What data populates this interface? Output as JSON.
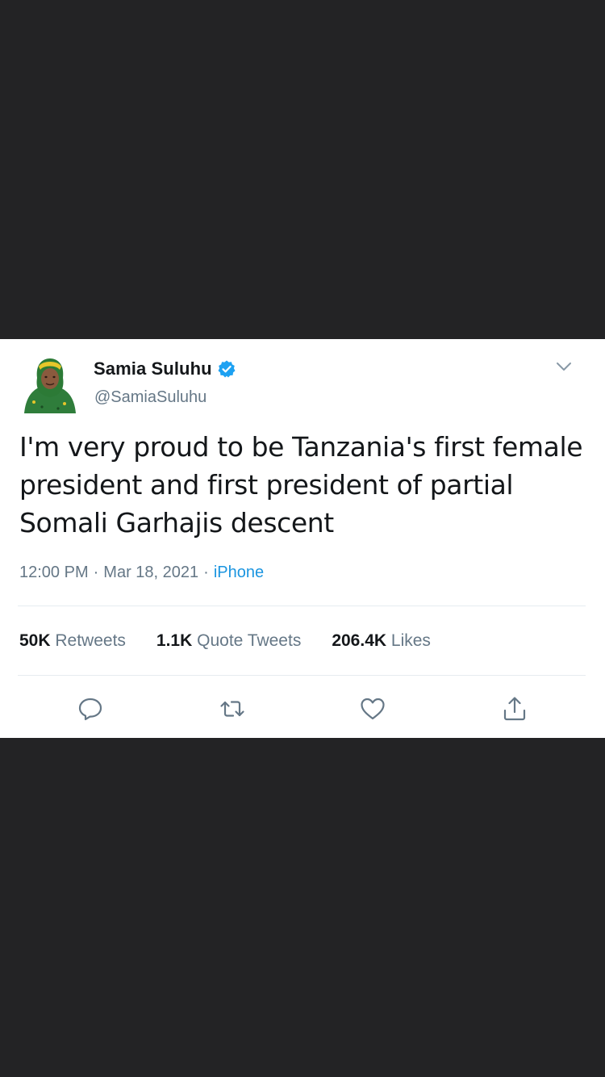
{
  "tweet": {
    "author": {
      "display_name": "Samia Suluhu",
      "handle": "@SamiaSuluhu",
      "verified": true,
      "avatar_icon": "profile-photo"
    },
    "text": "I'm very proud to be Tanzania's first female president and first president of partial Somali Garhajis descent",
    "time": "12:00 PM",
    "separator": "·",
    "date": "Mar 18, 2021",
    "source": "iPhone",
    "stats": {
      "retweets_count": "50K",
      "retweets_label": "Retweets",
      "quotes_count": "1.1K",
      "quotes_label": "Quote Tweets",
      "likes_count": "206.4K",
      "likes_label": "Likes"
    },
    "actions": [
      "reply-icon",
      "retweet-icon",
      "like-icon",
      "share-icon"
    ],
    "menu_icon": "chevron-down-icon"
  },
  "colors": {
    "background": "#232325",
    "card": "#ffffff",
    "text_primary": "#14171a",
    "text_secondary": "#657786",
    "link": "#1b95e0",
    "verified": "#1da1f2"
  }
}
